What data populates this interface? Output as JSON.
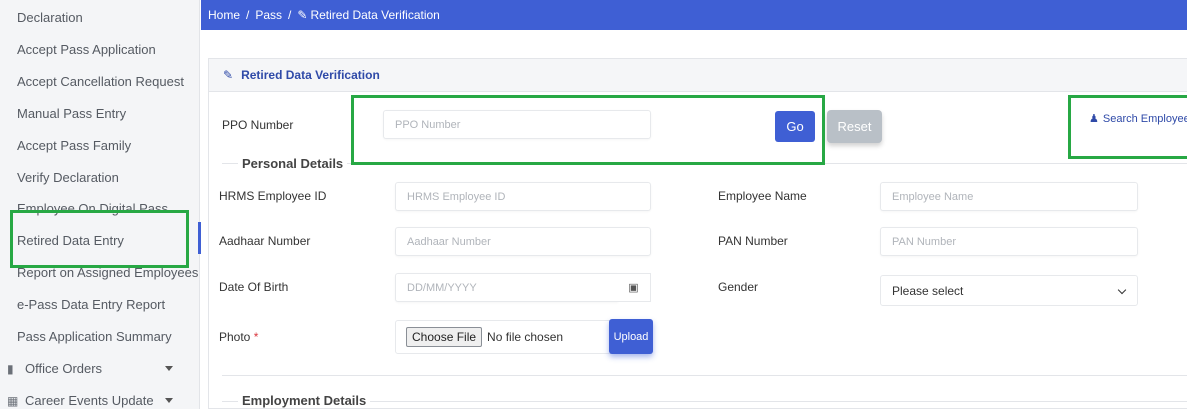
{
  "sidebar": {
    "items": [
      {
        "label": "Declaration"
      },
      {
        "label": "Accept Pass Application"
      },
      {
        "label": "Accept Cancellation Request"
      },
      {
        "label": "Manual Pass Entry"
      },
      {
        "label": "Accept Pass Family"
      },
      {
        "label": "Verify Declaration"
      },
      {
        "label": "Employee On Digital Pass"
      },
      {
        "label": "Retired Data Entry"
      },
      {
        "label": "Report on Assigned Employees"
      },
      {
        "label": "e-Pass Data Entry Report"
      },
      {
        "label": "Pass Application Summary"
      }
    ],
    "groups": [
      {
        "label": "Office Orders",
        "icon": "document-icon"
      },
      {
        "label": "Career Events Update",
        "icon": "table-icon"
      }
    ]
  },
  "breadcrumb": {
    "home": "Home",
    "sep1": "/",
    "pass": "Pass",
    "sep2": "/",
    "current": "Retired Data Verification"
  },
  "panel": {
    "title": "Retired Data Verification"
  },
  "ppo": {
    "label": "PPO Number",
    "placeholder": "PPO Number",
    "go_label": "Go",
    "reset_label": "Reset",
    "search_employee_label": "Search Employee"
  },
  "personal": {
    "legend": "Personal Details",
    "hrms_label": "HRMS Employee ID",
    "hrms_placeholder": "HRMS Employee ID",
    "name_label": "Employee Name",
    "name_placeholder": "Employee Name",
    "aadhaar_label": "Aadhaar Number",
    "aadhaar_placeholder": "Aadhaar Number",
    "pan_label": "PAN Number",
    "pan_placeholder": "PAN Number",
    "dob_label": "Date Of Birth",
    "dob_placeholder": "DD/MM/YYYY",
    "gender_label": "Gender",
    "gender_value": "Please select",
    "photo_label": "Photo",
    "photo_required": "*",
    "choose_file": "Choose File",
    "no_file": "No file chosen",
    "upload_label": "Upload"
  },
  "employment": {
    "legend": "Employment Details"
  },
  "colors": {
    "primary": "#3f5fd4",
    "highlight": "#27a844",
    "reset": "#b9c0c7"
  }
}
